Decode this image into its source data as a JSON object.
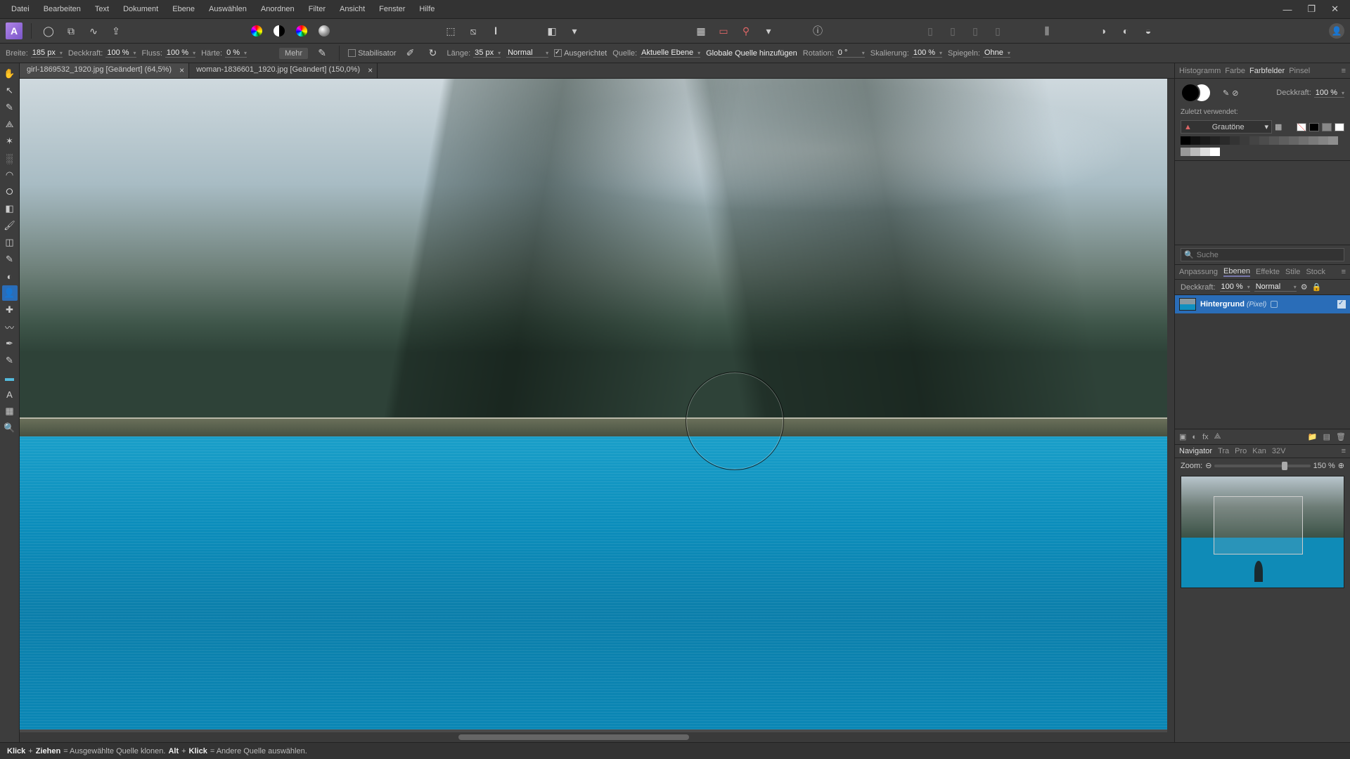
{
  "menu": [
    "Datei",
    "Bearbeiten",
    "Text",
    "Dokument",
    "Ebene",
    "Auswählen",
    "Anordnen",
    "Filter",
    "Ansicht",
    "Fenster",
    "Hilfe"
  ],
  "context": {
    "width_label": "Breite:",
    "width_value": "185 px",
    "opacity_label": "Deckkraft:",
    "opacity_value": "100 %",
    "flow_label": "Fluss:",
    "flow_value": "100 %",
    "hardness_label": "Härte:",
    "hardness_value": "0 %",
    "more": "Mehr",
    "stabilizer": "Stabilisator",
    "length_label": "Länge:",
    "length_value": "35 px",
    "blend": "Normal",
    "aligned": "Ausgerichtet",
    "source_label": "Quelle:",
    "source_value": "Aktuelle Ebene",
    "add_global": "Globale Quelle hinzufügen",
    "rotation_label": "Rotation:",
    "rotation_value": "0 °",
    "scale_label": "Skalierung:",
    "scale_value": "100 %",
    "mirror_label": "Spiegeln:",
    "mirror_value": "Ohne"
  },
  "tabs": {
    "tab1": "girl-1869532_1920.jpg [Geändert] (64,5%)",
    "tab2": "woman-1836601_1920.jpg [Geändert] (150,0%)"
  },
  "right": {
    "top_tabs": [
      "Histogramm",
      "Farbe",
      "Farbfelder",
      "Pinsel"
    ],
    "color_opacity_label": "Deckkraft:",
    "color_opacity_value": "100 %",
    "recent_label": "Zuletzt verwendet:",
    "gradient_preset": "Grautöne",
    "search_placeholder": "Suche",
    "mid_tabs": [
      "Anpassung",
      "Ebenen",
      "Effekte",
      "Stile",
      "Stock"
    ],
    "layer_opacity_label": "Deckkraft:",
    "layer_opacity_value": "100 %",
    "layer_blend": "Normal",
    "layer_name": "Hintergrund",
    "layer_type": "(Pixel)",
    "nav_tabs": [
      "Navigator",
      "Tra",
      "Pro",
      "Kan",
      "32V"
    ],
    "zoom_label": "Zoom:",
    "zoom_value": "150 %"
  },
  "status": {
    "s1a": "Klick",
    "s1b": "Ziehen",
    "s1c": " = Ausgewählte Quelle klonen. ",
    "s2a": "Alt",
    "s2b": "Klick",
    "s2c": " = Andere Quelle auswählen."
  },
  "colors": {
    "accent": "#2a6db8"
  }
}
